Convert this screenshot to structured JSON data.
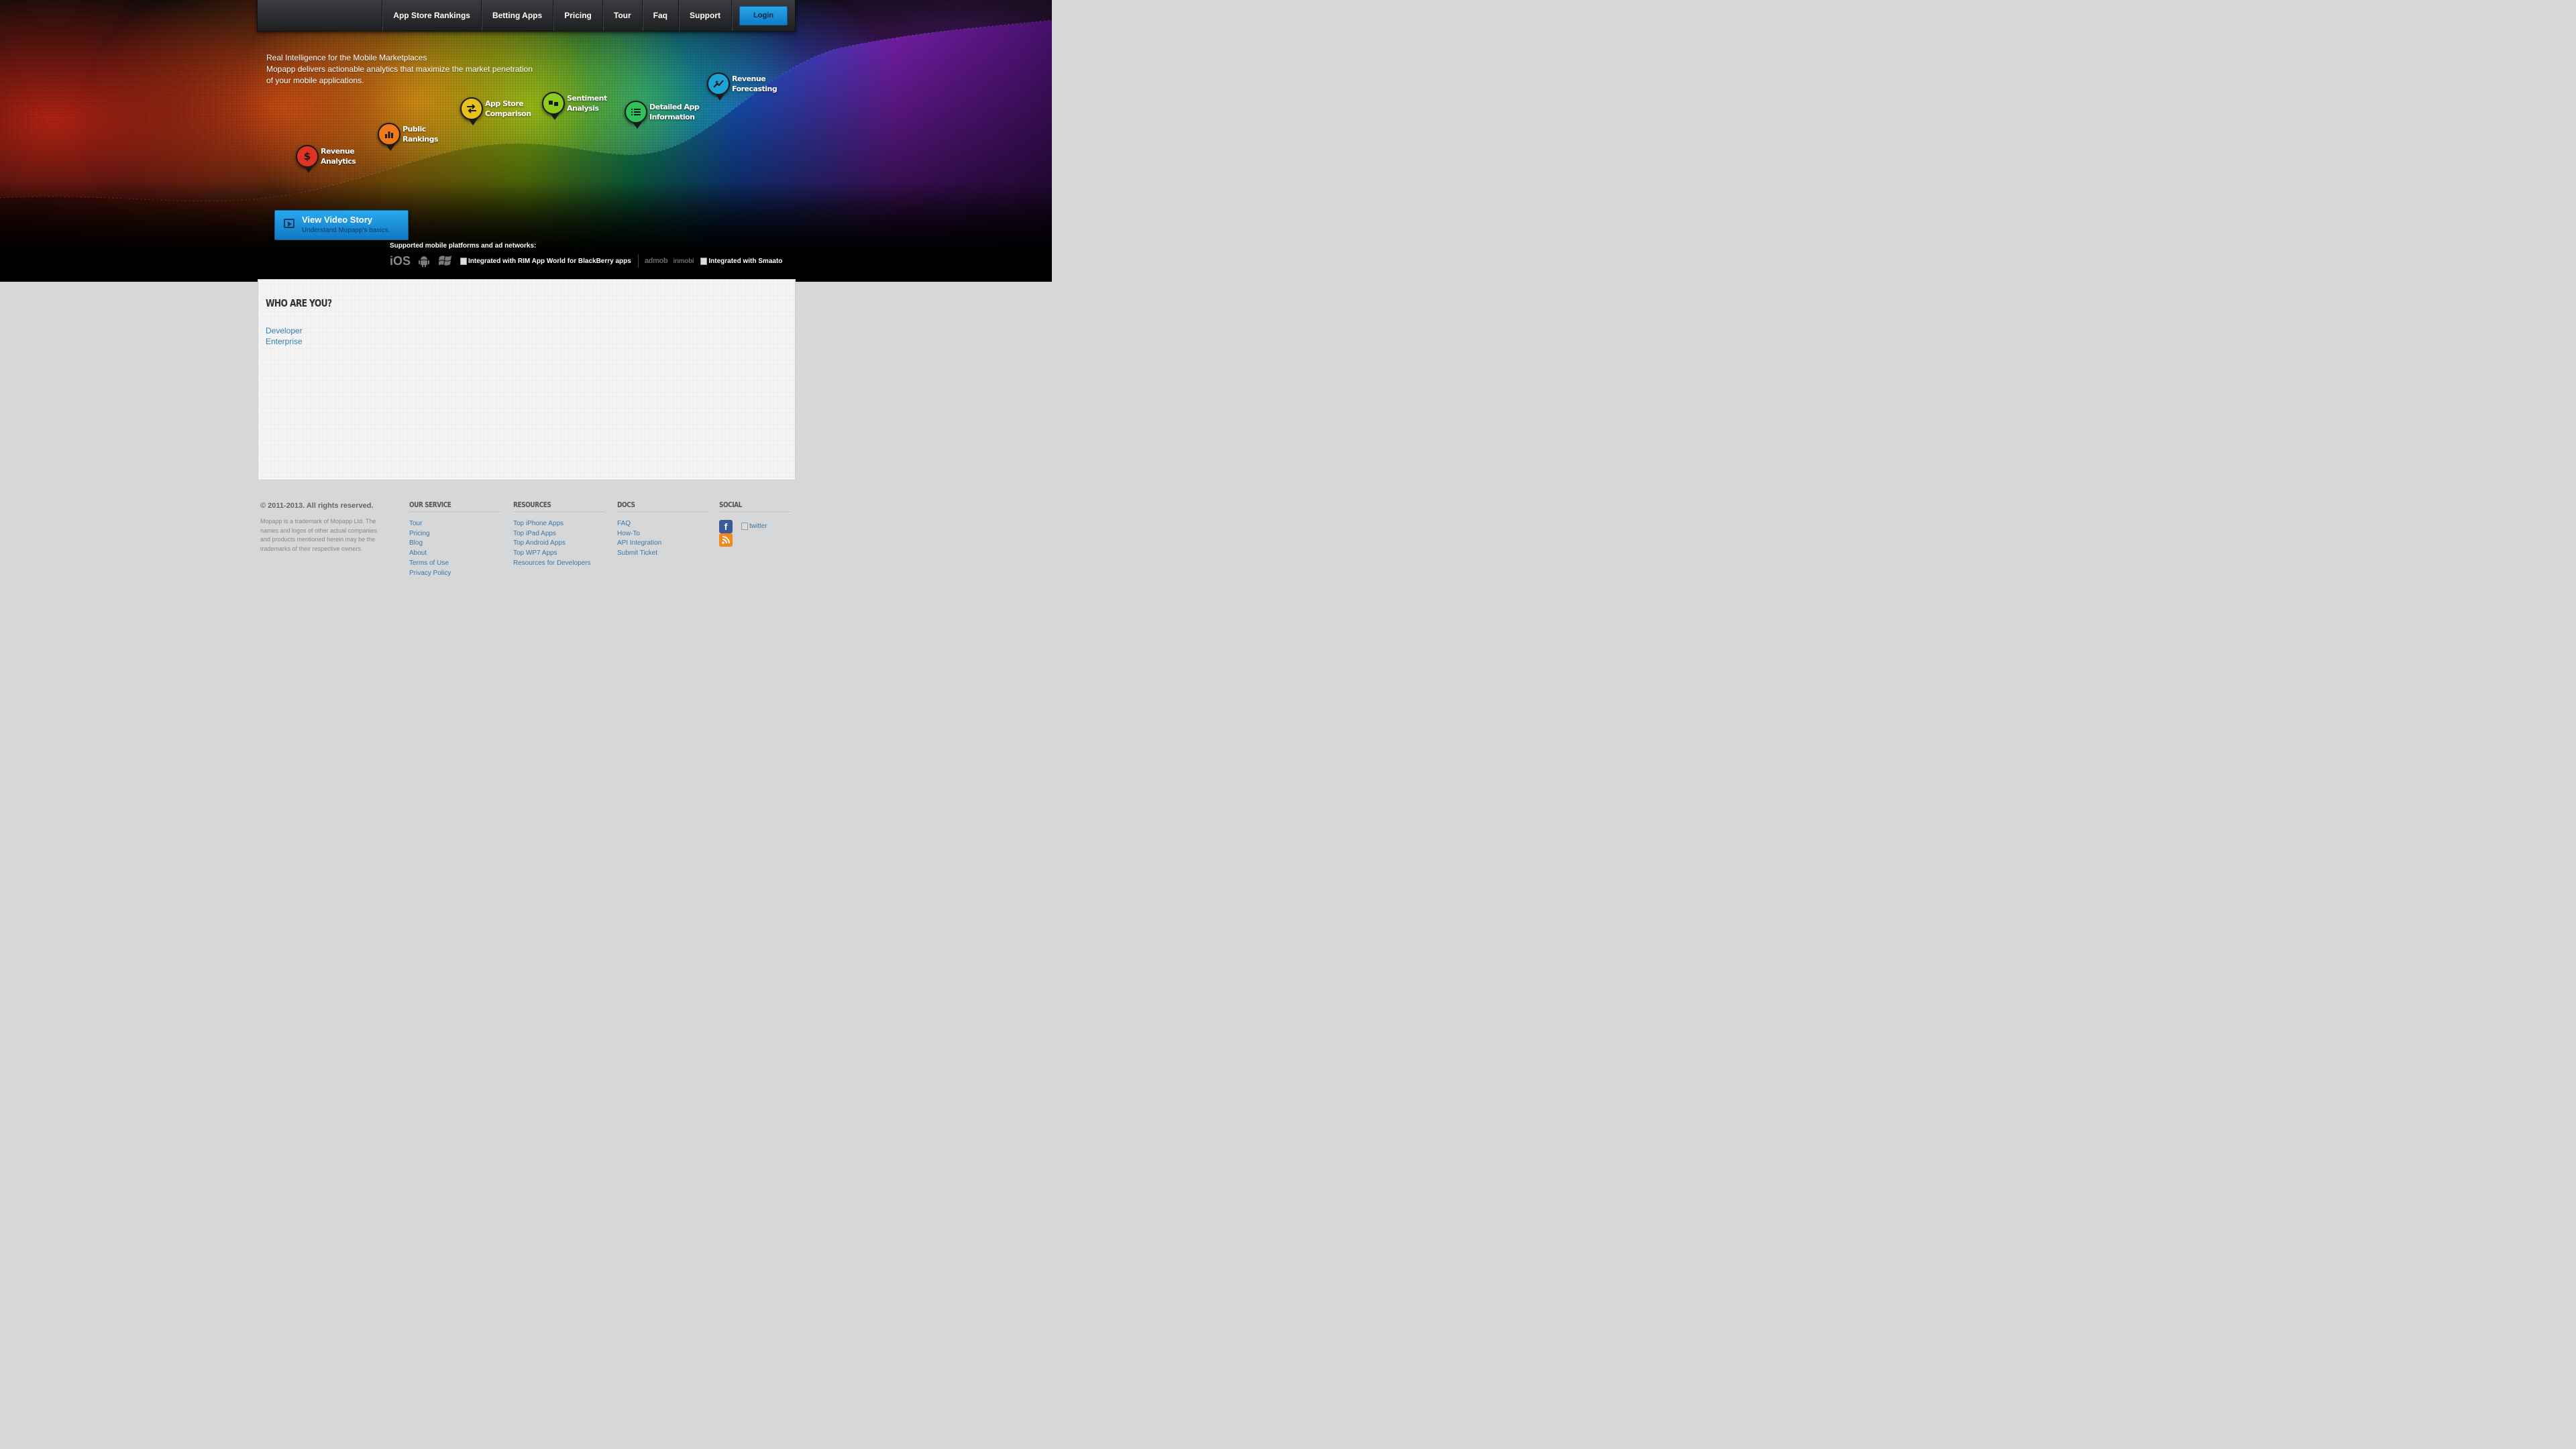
{
  "nav": {
    "items": [
      "App Store Rankings",
      "Betting Apps",
      "Pricing",
      "Tour",
      "Faq",
      "Support"
    ],
    "login_label": "Login"
  },
  "hero": {
    "headline": "Real Intelligence for the Mobile Marketplaces",
    "description": "Mopapp delivers actionable analytics that maximize the market penetration of your mobile applications."
  },
  "features": [
    {
      "label": "Revenue\nAnalytics",
      "icon": "dollar-icon",
      "color": "#e03324"
    },
    {
      "label": "Public\nRankings",
      "icon": "bar-chart-icon",
      "color": "#f07a1a"
    },
    {
      "label": "App Store\nComparison",
      "icon": "swap-arrows-icon",
      "color": "#e8c21b"
    },
    {
      "label": "Sentiment\nAnalysis",
      "icon": "thumbs-icon",
      "color": "#8dcc1d"
    },
    {
      "label": "Detailed App\nInformation",
      "icon": "list-icon",
      "color": "#2ec25a"
    },
    {
      "label": "Revenue\nForecasting",
      "icon": "forecast-icon",
      "color": "#1ea3d6"
    }
  ],
  "video": {
    "title": "View Video Story",
    "subtitle": "Understand Mopapp's basics."
  },
  "platforms": {
    "label": "Supported mobile platforms and ad networks:",
    "ios": "iOS",
    "blackberry_alt": "Integrated with RIM App World for BlackBerry apps",
    "admob": "admob",
    "inmobi": "inmobi",
    "smaato_alt": "Integrated with Smaato"
  },
  "main": {
    "title": "WHO ARE YOU?",
    "links": [
      "Developer",
      "Enterprise"
    ]
  },
  "footer": {
    "copyright": "© 2011-2013. All rights reserved.",
    "legal": "Mopapp is a trademark of Mopapp Ltd. The names and logos of other actual companies and products mentioned herein may be the trademarks of their respective owners.",
    "columns": [
      {
        "title": "OUR SERVICE",
        "links": [
          "Tour",
          "Pricing",
          "Blog",
          "About",
          "Terms of Use",
          "Privacy Policy"
        ]
      },
      {
        "title": "RESOURCES",
        "links": [
          "Top iPhone Apps",
          "Top iPad Apps",
          "Top Android Apps",
          "Top WP7 Apps",
          "Resources for Developers"
        ]
      },
      {
        "title": "DOCS",
        "links": [
          "FAQ",
          "How-To",
          "API Integration",
          "Submit Ticket"
        ]
      },
      {
        "title": "SOCIAL",
        "links": []
      }
    ],
    "social": {
      "facebook_icon": "f",
      "twitter_alt": "twitter"
    }
  }
}
